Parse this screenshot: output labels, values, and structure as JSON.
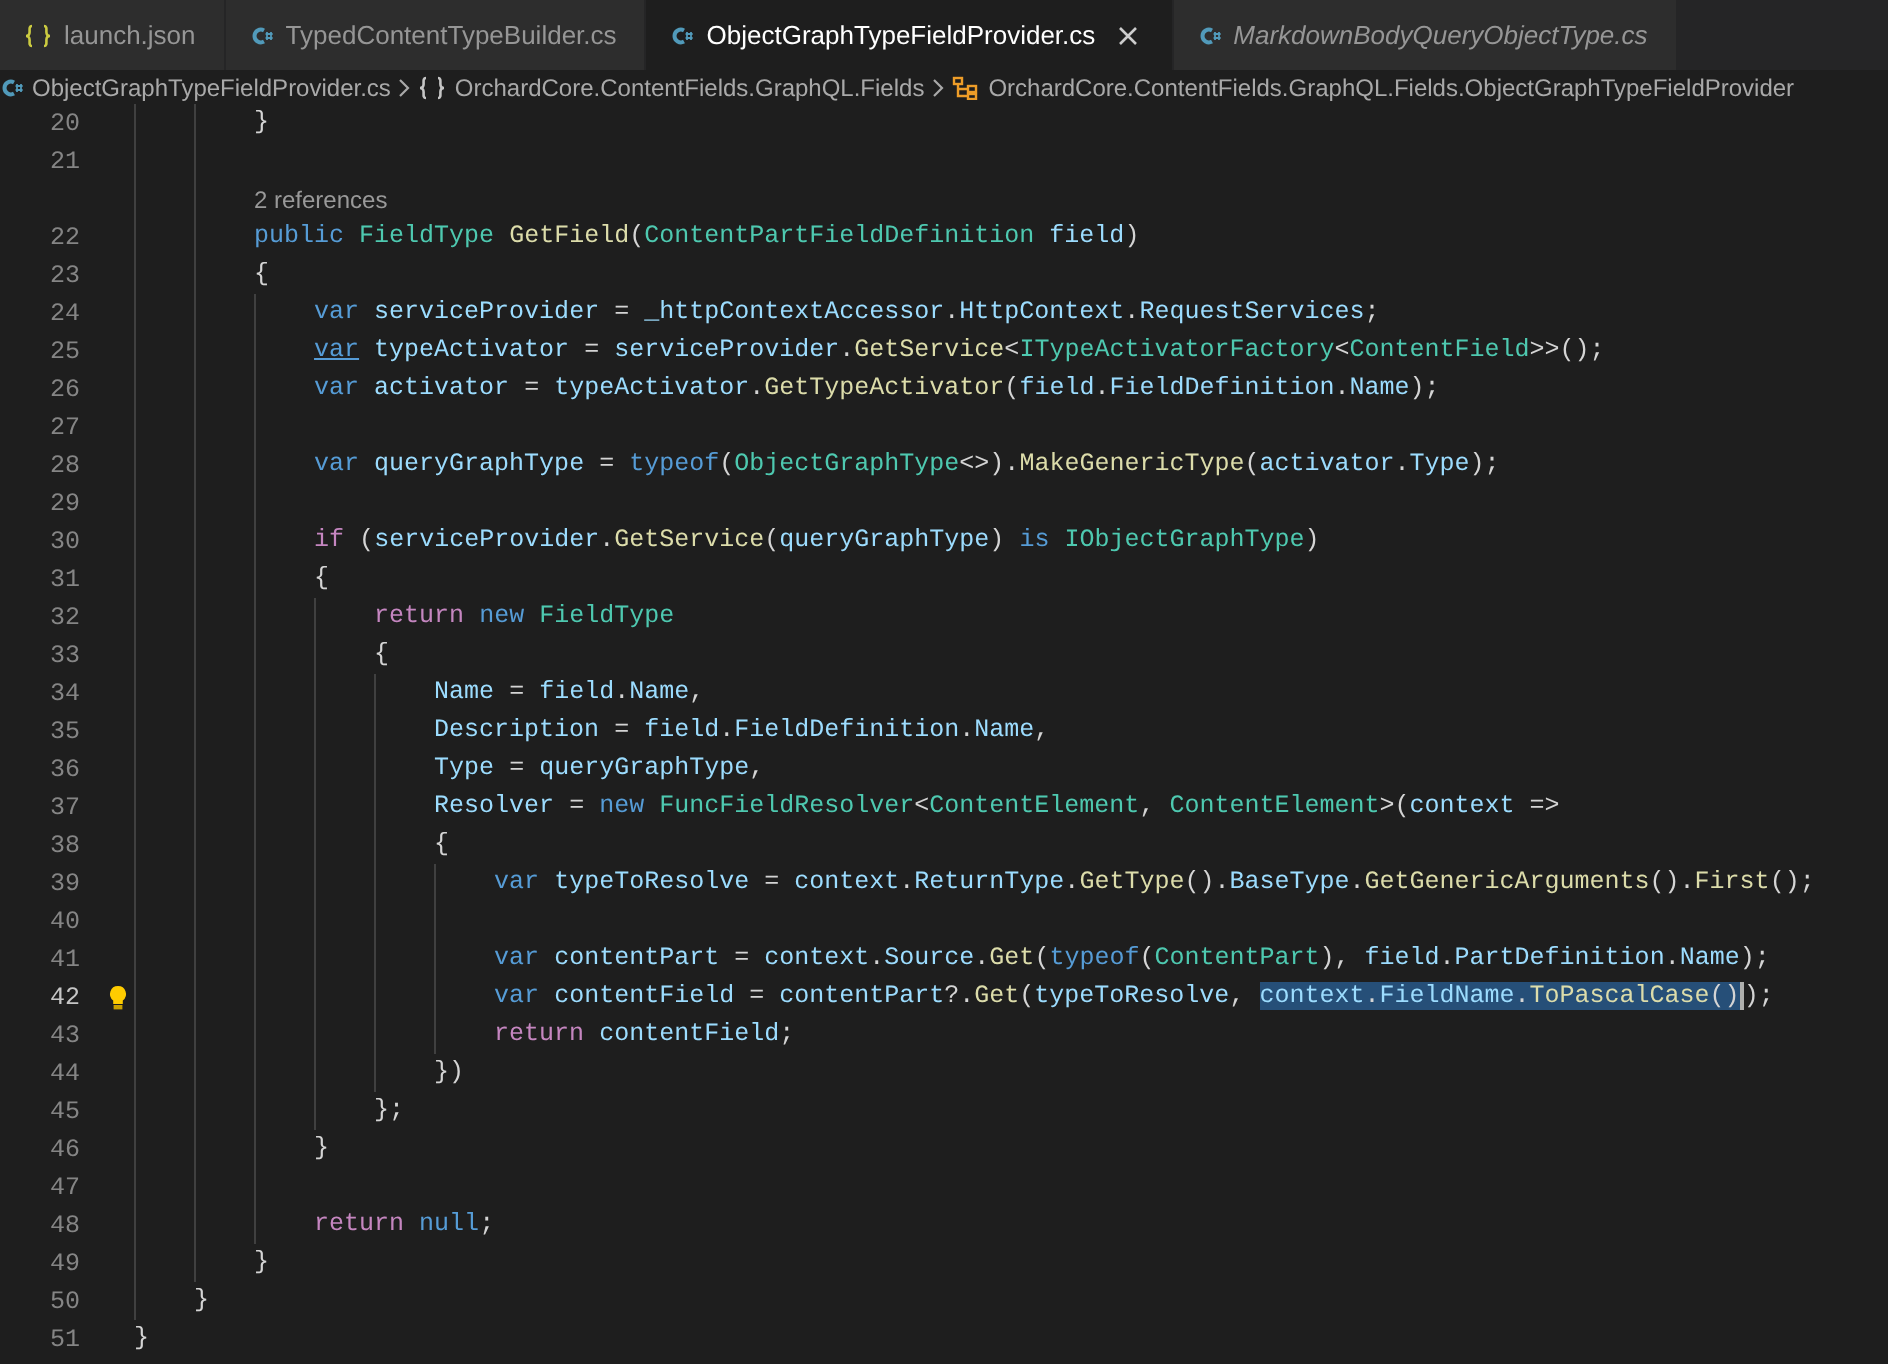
{
  "tabs": [
    {
      "label": "launch.json",
      "kind": "json",
      "selected": false,
      "preview": false
    },
    {
      "label": "TypedContentTypeBuilder.cs",
      "kind": "csharp",
      "selected": false,
      "preview": false
    },
    {
      "label": "ObjectGraphTypeFieldProvider.cs",
      "kind": "csharp",
      "selected": true,
      "preview": false
    },
    {
      "label": "MarkdownBodyQueryObjectType.cs",
      "kind": "csharp",
      "selected": false,
      "preview": true
    }
  ],
  "breadcrumbs": [
    {
      "label": "ObjectGraphTypeFieldProvider.cs",
      "kind": "file"
    },
    {
      "label": "OrchardCore.ContentFields.GraphQL.Fields",
      "kind": "namespace"
    },
    {
      "label": "OrchardCore.ContentFields.GraphQL.Fields.ObjectGraphTypeFieldProvider",
      "kind": "class"
    }
  ],
  "code_lines": [
    {
      "kind": "code",
      "number": "20",
      "active": false,
      "tokens": [
        {
          "text": "        }",
          "kind": "plain"
        }
      ]
    },
    {
      "kind": "code",
      "number": "21",
      "active": false
    },
    {
      "kind": "lens",
      "text": "2 references"
    },
    {
      "kind": "code",
      "number": "22",
      "active": false,
      "tokens": [
        {
          "text": "        public",
          "kind": "keyword"
        },
        {
          "text": " FieldType",
          "kind": "type"
        },
        {
          "text": " GetField",
          "kind": "function"
        },
        {
          "text": "(",
          "kind": "plain"
        },
        {
          "text": "ContentPartFieldDefinition",
          "kind": "type"
        },
        {
          "text": " field",
          "kind": "variable"
        },
        {
          "text": ")",
          "kind": "plain"
        }
      ]
    },
    {
      "kind": "code",
      "number": "23",
      "active": false,
      "tokens": [
        {
          "text": "        {",
          "kind": "plain"
        }
      ]
    },
    {
      "kind": "code",
      "number": "24",
      "active": false,
      "tokens": [
        {
          "text": "            var",
          "kind": "keyword"
        },
        {
          "text": " serviceProvider",
          "kind": "variable"
        },
        {
          "text": " = ",
          "kind": "plain"
        },
        {
          "text": "_httpContextAccessor",
          "kind": "variable"
        },
        {
          "text": ".",
          "kind": "plain"
        },
        {
          "text": "HttpContext",
          "kind": "variable"
        },
        {
          "text": ".",
          "kind": "plain"
        },
        {
          "text": "RequestServices",
          "kind": "variable"
        },
        {
          "text": ";",
          "kind": "plain"
        }
      ]
    },
    {
      "kind": "code",
      "number": "25",
      "active": false,
      "tokens": [
        {
          "text": "            var",
          "kind": "underlined"
        },
        {
          "text": " typeActivator",
          "kind": "variable"
        },
        {
          "text": " = ",
          "kind": "plain"
        },
        {
          "text": "serviceProvider",
          "kind": "variable"
        },
        {
          "text": ".",
          "kind": "plain"
        },
        {
          "text": "GetService",
          "kind": "function"
        },
        {
          "text": "<",
          "kind": "plain"
        },
        {
          "text": "ITypeActivatorFactory",
          "kind": "type"
        },
        {
          "text": "<",
          "kind": "plain"
        },
        {
          "text": "ContentField",
          "kind": "type"
        },
        {
          "text": ">>();",
          "kind": "plain"
        }
      ]
    },
    {
      "kind": "code",
      "number": "26",
      "active": false,
      "tokens": [
        {
          "text": "            var",
          "kind": "keyword"
        },
        {
          "text": " activator",
          "kind": "variable"
        },
        {
          "text": " = ",
          "kind": "plain"
        },
        {
          "text": "typeActivator",
          "kind": "variable"
        },
        {
          "text": ".",
          "kind": "plain"
        },
        {
          "text": "GetTypeActivator",
          "kind": "function"
        },
        {
          "text": "(",
          "kind": "plain"
        },
        {
          "text": "field",
          "kind": "variable"
        },
        {
          "text": ".",
          "kind": "plain"
        },
        {
          "text": "FieldDefinition",
          "kind": "variable"
        },
        {
          "text": ".",
          "kind": "plain"
        },
        {
          "text": "Name",
          "kind": "variable"
        },
        {
          "text": ");",
          "kind": "plain"
        }
      ]
    },
    {
      "kind": "code",
      "number": "27",
      "active": false
    },
    {
      "kind": "code",
      "number": "28",
      "active": false,
      "tokens": [
        {
          "text": "            var",
          "kind": "keyword"
        },
        {
          "text": " queryGraphType",
          "kind": "variable"
        },
        {
          "text": " = ",
          "kind": "plain"
        },
        {
          "text": "typeof",
          "kind": "keyword"
        },
        {
          "text": "(",
          "kind": "plain"
        },
        {
          "text": "ObjectGraphType",
          "kind": "type"
        },
        {
          "text": "<>).",
          "kind": "plain"
        },
        {
          "text": "MakeGenericType",
          "kind": "function"
        },
        {
          "text": "(",
          "kind": "plain"
        },
        {
          "text": "activator",
          "kind": "variable"
        },
        {
          "text": ".",
          "kind": "plain"
        },
        {
          "text": "Type",
          "kind": "variable"
        },
        {
          "text": ");",
          "kind": "plain"
        }
      ]
    },
    {
      "kind": "code",
      "number": "29",
      "active": false
    },
    {
      "kind": "code",
      "number": "30",
      "active": false,
      "tokens": [
        {
          "text": "            if",
          "kind": "control"
        },
        {
          "text": " (",
          "kind": "plain"
        },
        {
          "text": "serviceProvider",
          "kind": "variable"
        },
        {
          "text": ".",
          "kind": "plain"
        },
        {
          "text": "GetService",
          "kind": "function"
        },
        {
          "text": "(",
          "kind": "plain"
        },
        {
          "text": "queryGraphType",
          "kind": "variable"
        },
        {
          "text": ") ",
          "kind": "plain"
        },
        {
          "text": "is",
          "kind": "keyword"
        },
        {
          "text": " IObjectGraphType",
          "kind": "type"
        },
        {
          "text": ")",
          "kind": "plain"
        }
      ]
    },
    {
      "kind": "code",
      "number": "31",
      "active": false,
      "tokens": [
        {
          "text": "            {",
          "kind": "plain"
        }
      ]
    },
    {
      "kind": "code",
      "number": "32",
      "active": false,
      "tokens": [
        {
          "text": "                return",
          "kind": "control"
        },
        {
          "text": " new",
          "kind": "keyword"
        },
        {
          "text": " FieldType",
          "kind": "type"
        }
      ]
    },
    {
      "kind": "code",
      "number": "33",
      "active": false,
      "tokens": [
        {
          "text": "                {",
          "kind": "plain"
        }
      ]
    },
    {
      "kind": "code",
      "number": "34",
      "active": false,
      "tokens": [
        {
          "text": "                    Name",
          "kind": "variable"
        },
        {
          "text": " = ",
          "kind": "plain"
        },
        {
          "text": "field",
          "kind": "variable"
        },
        {
          "text": ".",
          "kind": "plain"
        },
        {
          "text": "Name",
          "kind": "variable"
        },
        {
          "text": ",",
          "kind": "plain"
        }
      ]
    },
    {
      "kind": "code",
      "number": "35",
      "active": false,
      "tokens": [
        {
          "text": "                    Description",
          "kind": "variable"
        },
        {
          "text": " = ",
          "kind": "plain"
        },
        {
          "text": "field",
          "kind": "variable"
        },
        {
          "text": ".",
          "kind": "plain"
        },
        {
          "text": "FieldDefinition",
          "kind": "variable"
        },
        {
          "text": ".",
          "kind": "plain"
        },
        {
          "text": "Name",
          "kind": "variable"
        },
        {
          "text": ",",
          "kind": "plain"
        }
      ]
    },
    {
      "kind": "code",
      "number": "36",
      "active": false,
      "tokens": [
        {
          "text": "                    Type",
          "kind": "variable"
        },
        {
          "text": " = ",
          "kind": "plain"
        },
        {
          "text": "queryGraphType",
          "kind": "variable"
        },
        {
          "text": ",",
          "kind": "plain"
        }
      ]
    },
    {
      "kind": "code",
      "number": "37",
      "active": false,
      "tokens": [
        {
          "text": "                    Resolver",
          "kind": "variable"
        },
        {
          "text": " = ",
          "kind": "plain"
        },
        {
          "text": "new",
          "kind": "keyword"
        },
        {
          "text": " FuncFieldResolver",
          "kind": "type"
        },
        {
          "text": "<",
          "kind": "plain"
        },
        {
          "text": "ContentElement",
          "kind": "type"
        },
        {
          "text": ", ",
          "kind": "plain"
        },
        {
          "text": "ContentElement",
          "kind": "type"
        },
        {
          "text": ">(",
          "kind": "plain"
        },
        {
          "text": "context",
          "kind": "variable"
        },
        {
          "text": " =>",
          "kind": "plain"
        }
      ]
    },
    {
      "kind": "code",
      "number": "38",
      "active": false,
      "tokens": [
        {
          "text": "                    {",
          "kind": "plain"
        }
      ]
    },
    {
      "kind": "code",
      "number": "39",
      "active": false,
      "tokens": [
        {
          "text": "                        var",
          "kind": "keyword"
        },
        {
          "text": " typeToResolve",
          "kind": "variable"
        },
        {
          "text": " = ",
          "kind": "plain"
        },
        {
          "text": "context",
          "kind": "variable"
        },
        {
          "text": ".",
          "kind": "plain"
        },
        {
          "text": "ReturnType",
          "kind": "variable"
        },
        {
          "text": ".",
          "kind": "plain"
        },
        {
          "text": "GetType",
          "kind": "function"
        },
        {
          "text": "().",
          "kind": "plain"
        },
        {
          "text": "BaseType",
          "kind": "variable"
        },
        {
          "text": ".",
          "kind": "plain"
        },
        {
          "text": "GetGenericArguments",
          "kind": "function"
        },
        {
          "text": "().",
          "kind": "plain"
        },
        {
          "text": "First",
          "kind": "function"
        },
        {
          "text": "();",
          "kind": "plain"
        }
      ]
    },
    {
      "kind": "code",
      "number": "40",
      "active": false
    },
    {
      "kind": "code",
      "number": "41",
      "active": false,
      "tokens": [
        {
          "text": "                        var",
          "kind": "keyword"
        },
        {
          "text": " contentPart",
          "kind": "variable"
        },
        {
          "text": " = ",
          "kind": "plain"
        },
        {
          "text": "context",
          "kind": "variable"
        },
        {
          "text": ".",
          "kind": "plain"
        },
        {
          "text": "Source",
          "kind": "variable"
        },
        {
          "text": ".",
          "kind": "plain"
        },
        {
          "text": "Get",
          "kind": "function"
        },
        {
          "text": "(",
          "kind": "plain"
        },
        {
          "text": "typeof",
          "kind": "keyword"
        },
        {
          "text": "(",
          "kind": "plain"
        },
        {
          "text": "ContentPart",
          "kind": "type"
        },
        {
          "text": "), ",
          "kind": "plain"
        },
        {
          "text": "field",
          "kind": "variable"
        },
        {
          "text": ".",
          "kind": "plain"
        },
        {
          "text": "PartDefinition",
          "kind": "variable"
        },
        {
          "text": ".",
          "kind": "plain"
        },
        {
          "text": "Name",
          "kind": "variable"
        },
        {
          "text": ");",
          "kind": "plain"
        }
      ]
    },
    {
      "kind": "code",
      "number": "42",
      "active": true,
      "tokens": [
        {
          "text": "                        var",
          "kind": "keyword"
        },
        {
          "text": " contentField",
          "kind": "variable"
        },
        {
          "text": " = ",
          "kind": "plain"
        },
        {
          "text": "contentPart",
          "kind": "variable"
        },
        {
          "text": "?.",
          "kind": "plain"
        },
        {
          "text": "Get",
          "kind": "function"
        },
        {
          "text": "(",
          "kind": "plain"
        },
        {
          "text": "typeToResolve",
          "kind": "variable"
        },
        {
          "text": ", ",
          "kind": "plain"
        }
      ],
      "selection": [
        {
          "text": "context",
          "kind": "variable"
        },
        {
          "text": ".",
          "kind": "plain"
        },
        {
          "text": "FieldName",
          "kind": "variable"
        },
        {
          "text": ".",
          "kind": "plain"
        },
        {
          "text": "ToPascalCase",
          "kind": "function"
        },
        {
          "text": "()",
          "kind": "plain"
        }
      ],
      "after": [
        {
          "text": ");",
          "kind": "plain"
        }
      ]
    },
    {
      "kind": "code",
      "number": "43",
      "active": false,
      "tokens": [
        {
          "text": "                        return",
          "kind": "control"
        },
        {
          "text": " contentField",
          "kind": "variable"
        },
        {
          "text": ";",
          "kind": "plain"
        }
      ]
    },
    {
      "kind": "code",
      "number": "44",
      "active": false,
      "tokens": [
        {
          "text": "                    })",
          "kind": "plain"
        }
      ]
    },
    {
      "kind": "code",
      "number": "45",
      "active": false,
      "tokens": [
        {
          "text": "                };",
          "kind": "plain"
        }
      ]
    },
    {
      "kind": "code",
      "number": "46",
      "active": false,
      "tokens": [
        {
          "text": "            }",
          "kind": "plain"
        }
      ]
    },
    {
      "kind": "code",
      "number": "47",
      "active": false
    },
    {
      "kind": "code",
      "number": "48",
      "active": false,
      "tokens": [
        {
          "text": "            return",
          "kind": "control"
        },
        {
          "text": " null",
          "kind": "keyword"
        },
        {
          "text": ";",
          "kind": "plain"
        }
      ]
    },
    {
      "kind": "code",
      "number": "49",
      "active": false,
      "tokens": [
        {
          "text": "        }",
          "kind": "plain"
        }
      ]
    },
    {
      "kind": "code",
      "number": "50",
      "active": false,
      "tokens": [
        {
          "text": "    }",
          "kind": "plain"
        }
      ]
    },
    {
      "kind": "code",
      "number": "51",
      "active": false,
      "tokens": [
        {
          "text": "}",
          "kind": "plain"
        }
      ]
    }
  ]
}
